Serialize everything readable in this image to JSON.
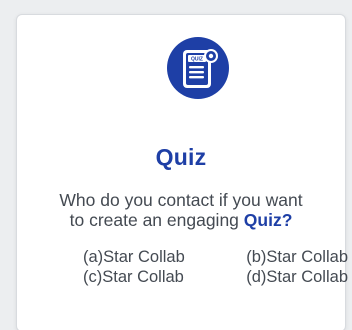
{
  "card": {
    "icon": "quiz-document-icon",
    "icon_text": "QUIZ",
    "title": "Quiz",
    "question": {
      "line1": "Who do you contact if you want",
      "line2_prefix": "to create an engaging ",
      "line2_emphasis": "Quiz?"
    },
    "options": [
      "(a)Star Collab",
      "(b)Star Collab",
      "(c)Star Collab",
      "(d)Star Collab"
    ]
  },
  "colors": {
    "accent": "#1e3fa6",
    "text": "#444a52",
    "card_bg": "#ffffff",
    "page_bg": "#eceef0"
  }
}
